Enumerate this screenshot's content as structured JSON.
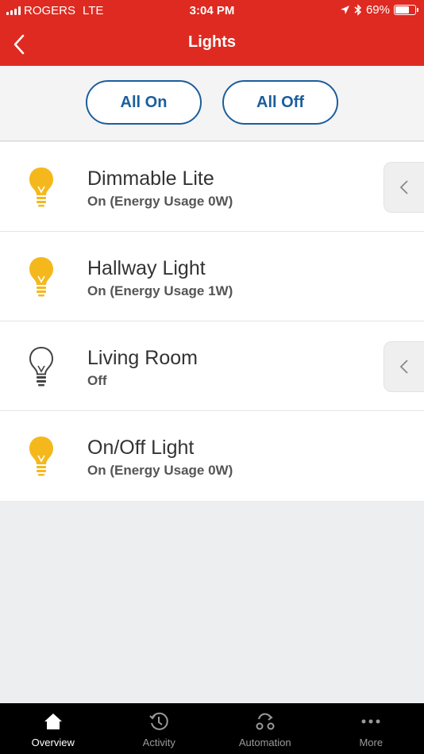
{
  "status_bar": {
    "carrier": "ROGERS",
    "network": "LTE",
    "time": "3:04 PM",
    "battery_percent": "69%",
    "battery_level": 0.69,
    "icons": [
      "signal-icon",
      "location-arrow-icon",
      "bluetooth-icon",
      "battery-icon"
    ]
  },
  "nav": {
    "title": "Lights",
    "back_icon": "chevron-left-icon"
  },
  "actions": {
    "all_on": "All On",
    "all_off": "All Off"
  },
  "colors": {
    "header_red": "#de2a20",
    "accent_blue": "#1b5e9c",
    "bulb_on": "#f5b81c",
    "bulb_off": "#444444"
  },
  "lights": [
    {
      "name": "Dimmable Lite",
      "status": "On (Energy Usage 0W)",
      "on": true,
      "has_slider_tab": true
    },
    {
      "name": "Hallway Light",
      "status": "On (Energy Usage 1W)",
      "on": true,
      "has_slider_tab": false
    },
    {
      "name": "Living Room",
      "status": "Off",
      "on": false,
      "has_slider_tab": true
    },
    {
      "name": "On/Off Light",
      "status": "On (Energy Usage 0W)",
      "on": true,
      "has_slider_tab": false
    }
  ],
  "tabs": [
    {
      "label": "Overview",
      "icon": "home-icon",
      "active": true
    },
    {
      "label": "Activity",
      "icon": "history-icon",
      "active": false
    },
    {
      "label": "Automation",
      "icon": "automation-icon",
      "active": false
    },
    {
      "label": "More",
      "icon": "more-dots-icon",
      "active": false
    }
  ]
}
